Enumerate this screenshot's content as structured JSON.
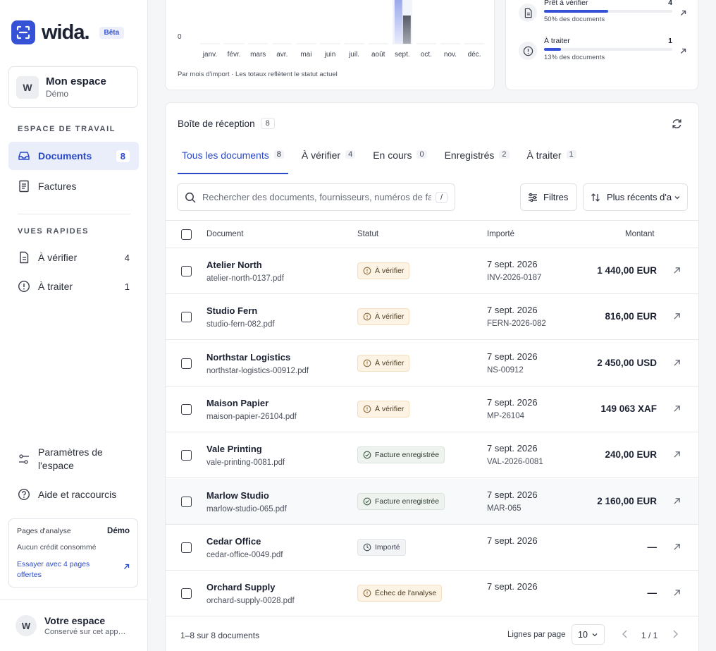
{
  "brand": {
    "name": "wida.",
    "badge": "Bêta",
    "accent": "#3552d6"
  },
  "workspace": {
    "initial": "W",
    "name": "Mon espace",
    "sub": "Démo"
  },
  "sidebar": {
    "work_label": "ESPACE DE TRAVAIL",
    "work_items": [
      {
        "label": "Documents",
        "count": "8",
        "icon": "inbox-icon"
      },
      {
        "label": "Factures",
        "count": "",
        "icon": "receipt-icon"
      }
    ],
    "quick_label": "VUES RAPIDES",
    "quick_items": [
      {
        "label": "À vérifier",
        "count": "4",
        "icon": "file-icon"
      },
      {
        "label": "À traiter",
        "count": "1",
        "icon": "alert-circle-icon"
      }
    ],
    "settings_label_1": "Paramètres de",
    "settings_label_2": "l'espace",
    "help_label": "Aide et raccourcis",
    "credits": {
      "title": "Pages d'analyse",
      "mode": "Démo",
      "sub": "Aucun crédit consommé",
      "link_1": "Essayer avec 4 pages",
      "link_2": "offertes"
    },
    "user": {
      "initial": "W",
      "name": "Votre espace",
      "sub": "Conservé sur cet app…"
    }
  },
  "chart_data": {
    "type": "bar",
    "categories": [
      "janv.",
      "févr.",
      "mars",
      "avr.",
      "mai",
      "juin",
      "juil.",
      "août",
      "sept.",
      "oct.",
      "nov.",
      "déc."
    ],
    "y_tick": "0",
    "footnote": "Par mois d'import · Les totaux reflètent le statut actuel"
  },
  "stats": [
    {
      "title": "Prêt à vérifier",
      "count": "4",
      "fraction": 0.5,
      "sub": "50% des documents",
      "icon": "file-icon"
    },
    {
      "title": "À traiter",
      "count": "1",
      "fraction": 0.13,
      "sub": "13% des documents",
      "icon": "alert-circle-icon"
    }
  ],
  "inbox": {
    "title": "Boîte de réception",
    "count": "8",
    "tabs": [
      {
        "label": "Tous les documents",
        "count": "8"
      },
      {
        "label": "À vérifier",
        "count": "4"
      },
      {
        "label": "En cours",
        "count": "0"
      },
      {
        "label": "Enregistrés",
        "count": "2"
      },
      {
        "label": "À traiter",
        "count": "1"
      }
    ],
    "search_placeholder": "Rechercher des documents, fournisseurs, numéros de fa",
    "search_shortcut": "/",
    "filter_label": "Filtres",
    "sort_label": "Plus récents d'a",
    "columns": {
      "document": "Document",
      "status": "Statut",
      "imported": "Importé",
      "amount": "Montant"
    },
    "rows": [
      {
        "name": "Atelier North",
        "file": "atelier-north-0137.pdf",
        "status": "À vérifier",
        "status_kind": "warn",
        "date": "7 sept. 2026",
        "ref": "INV-2026-0187",
        "amount": "1 440,00 EUR"
      },
      {
        "name": "Studio Fern",
        "file": "studio-fern-082.pdf",
        "status": "À vérifier",
        "status_kind": "warn",
        "date": "7 sept. 2026",
        "ref": "FERN-2026-082",
        "amount": "816,00 EUR"
      },
      {
        "name": "Northstar Logistics",
        "file": "northstar-logistics-00912.pdf",
        "status": "À vérifier",
        "status_kind": "warn",
        "date": "7 sept. 2026",
        "ref": "NS-00912",
        "amount": "2 450,00 USD"
      },
      {
        "name": "Maison Papier",
        "file": "maison-papier-26104.pdf",
        "status": "À vérifier",
        "status_kind": "warn",
        "date": "7 sept. 2026",
        "ref": "MP-26104",
        "amount": "149 063 XAF"
      },
      {
        "name": "Vale Printing",
        "file": "vale-printing-0081.pdf",
        "status": "Facture enregistrée",
        "status_kind": "ok",
        "date": "7 sept. 2026",
        "ref": "VAL-2026-0081",
        "amount": "240,00 EUR"
      },
      {
        "name": "Marlow Studio",
        "file": "marlow-studio-065.pdf",
        "status": "Facture enregistrée",
        "status_kind": "ok",
        "date": "7 sept. 2026",
        "ref": "MAR-065",
        "amount": "2 160,00 EUR"
      },
      {
        "name": "Cedar Office",
        "file": "cedar-office-0049.pdf",
        "status": "Importé",
        "status_kind": "neutral",
        "date": "7 sept. 2026",
        "ref": "",
        "amount": "—"
      },
      {
        "name": "Orchard Supply",
        "file": "orchard-supply-0028.pdf",
        "status": "Échec de l'analyse",
        "status_kind": "fail",
        "date": "7 sept. 2026",
        "ref": "",
        "amount": "—"
      }
    ],
    "footer": {
      "range": "1–8 sur 8 documents",
      "rows_per_page_label": "Lignes par page",
      "rows_per_page": "10",
      "page": "1 / 1"
    }
  }
}
